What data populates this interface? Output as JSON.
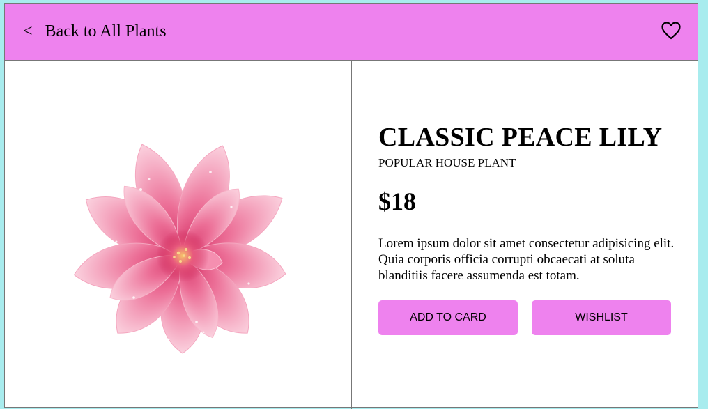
{
  "header": {
    "back_chevron": "<",
    "back_label": "Back to All Plants",
    "favorite_icon": "heart-outline-icon"
  },
  "product": {
    "image": "pink-flower-image",
    "title": "CLASSIC PEACE LILY",
    "subtitle": "POPULAR HOUSE PLANT",
    "price": "$18",
    "description": "Lorem ipsum dolor sit amet consectetur adipisicing elit. Quia corporis officia corrupti obcaecati at soluta blanditiis facere assumenda est totam."
  },
  "actions": {
    "add_label": "ADD TO CARD",
    "wishlist_label": "WISHLIST"
  },
  "colors": {
    "page_background": "#a8ecee",
    "accent": "#ee82ee",
    "card_background": "#ffffff",
    "border": "#777777"
  }
}
